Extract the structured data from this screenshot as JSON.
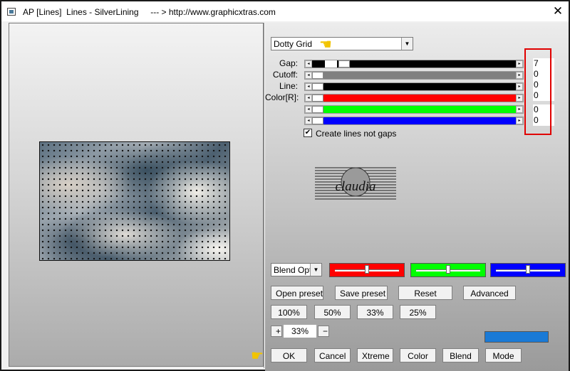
{
  "window": {
    "title": "AP [Lines]  Lines - SilverLining     --- > http://www.graphicxtras.com",
    "close_glyph": "✕"
  },
  "mode_select": {
    "value": "Dotty Grid"
  },
  "sliders": [
    {
      "label": "Gap:",
      "fill_color": "#000000",
      "value": "7",
      "thumb_level": 0.07
    },
    {
      "label": "Cutoff:",
      "fill_color": "#808080",
      "value": "0",
      "thumb_level": 0.0
    },
    {
      "label": "Line:",
      "fill_color": "#000000",
      "value": "0",
      "thumb_level": 0.0
    },
    {
      "label": "Color[R]:",
      "fill_color": "#ff0000",
      "value": "0",
      "thumb_level": 0.0
    },
    {
      "label": "",
      "fill_color": "#00ff00",
      "value": "0",
      "thumb_level": 0.0
    },
    {
      "label": "",
      "fill_color": "#0000ff",
      "value": "0",
      "thumb_level": 0.0
    }
  ],
  "checkbox": {
    "label": "Create lines not gaps",
    "checked": true,
    "mark": "✔"
  },
  "logo": {
    "text": "claudia"
  },
  "blend_select": {
    "value": "Blend Opti"
  },
  "color_sliders": [
    {
      "color": "#ff0000",
      "level": 0.5
    },
    {
      "color": "#00ff00",
      "level": 0.5
    },
    {
      "color": "#0000ff",
      "level": 0.5
    }
  ],
  "buttons": {
    "open_preset": "Open preset",
    "save_preset": "Save preset",
    "reset": "Reset",
    "advanced": "Advanced",
    "zoom_100": "100%",
    "zoom_50": "50%",
    "zoom_33": "33%",
    "zoom_25": "25%",
    "zoom_plus": "+",
    "zoom_minus": "−",
    "ok": "OK",
    "cancel": "Cancel",
    "xtreme": "Xtreme",
    "color": "Color",
    "blend": "Blend",
    "mode": "Mode"
  },
  "zoom": {
    "value": "33%"
  },
  "accent_swatch": "#1a7ad6",
  "icons": {
    "pointer": "pointing-hand-icon"
  }
}
